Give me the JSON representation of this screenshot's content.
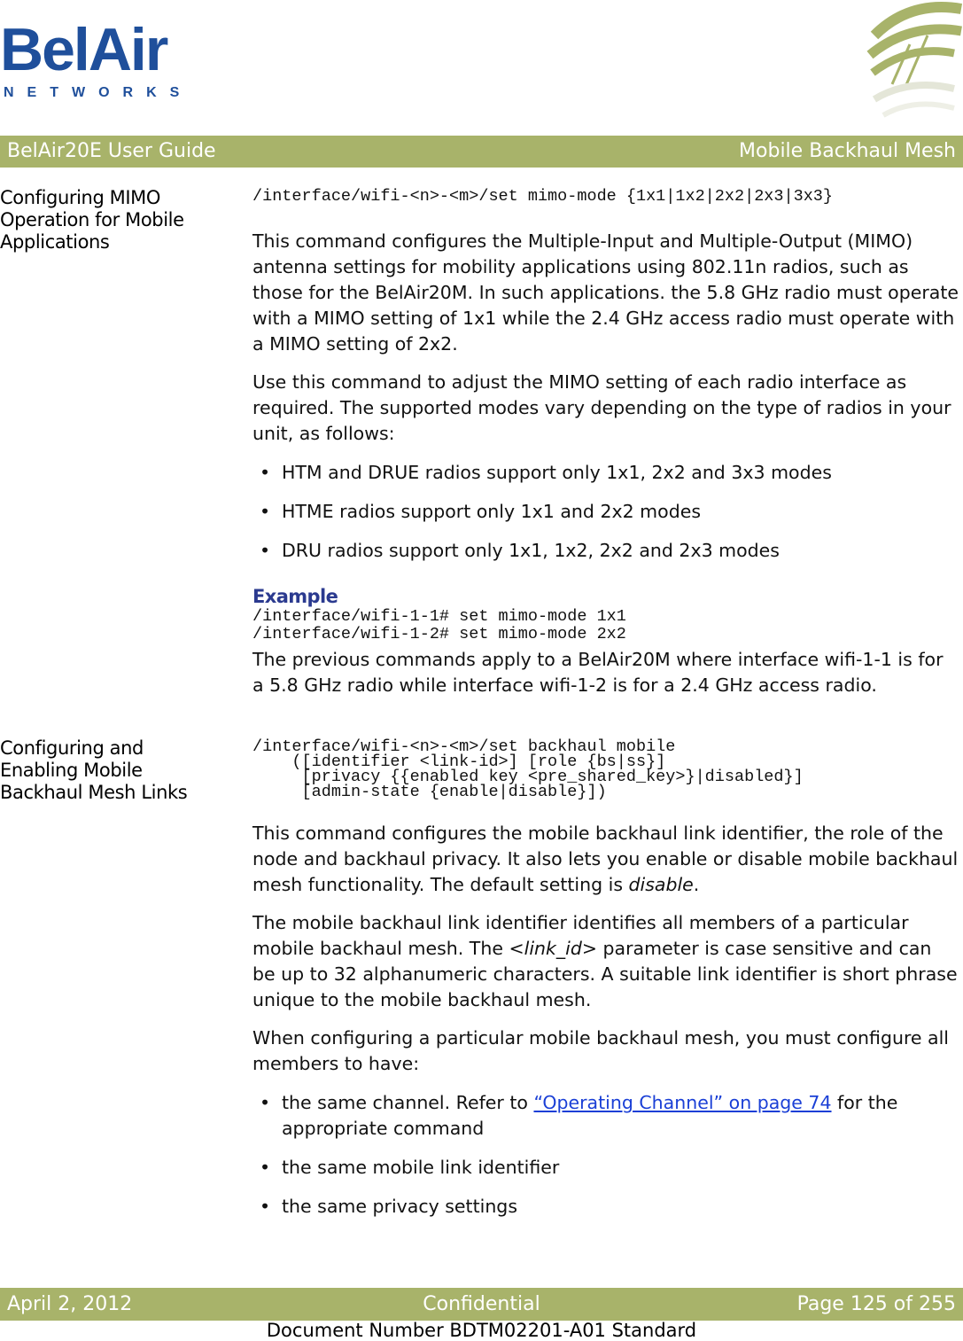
{
  "logo": {
    "word": "BelAir",
    "sub": "NETWORKS"
  },
  "header": {
    "left": "BelAir20E User Guide",
    "right": "Mobile Backhaul Mesh"
  },
  "section1": {
    "title_lines": [
      "Configuring MIMO",
      "Operation for Mobile",
      "Applications"
    ],
    "command": "/interface/wifi-<n>-<m>/set mimo-mode {1x1|1x2|2x2|2x3|3x3}",
    "para1": "This command configures the Multiple-Input and Multiple-Output (MIMO) antenna settings for mobility applications using 802.11n radios, such as those for the BelAir20M. In such applications. the 5.8 GHz radio must operate with a MIMO setting of 1x1 while the 2.4 GHz access radio must operate with a MIMO setting of 2x2.",
    "para2": "Use this command to adjust the MIMO setting of each radio interface as required. The supported modes vary depending on the type of radios in your unit, as follows:",
    "bullets": [
      "HTM and DRUE radios support only 1x1, 2x2 and 3x3 modes",
      "HTME radios support only 1x1 and 2x2 modes",
      "DRU radios support only 1x1, 1x2, 2x2 and 2x3 modes"
    ],
    "example_heading": "Example",
    "example_code": "/interface/wifi-1-1# set mimo-mode 1x1\n/interface/wifi-1-2# set mimo-mode 2x2",
    "para3": "The previous commands apply to a BelAir20M where interface wifi-1-1 is for a 5.8 GHz radio while interface wifi-1-2 is for a 2.4 GHz access radio."
  },
  "section2": {
    "title_lines": [
      "Configuring and",
      "Enabling Mobile",
      "Backhaul Mesh Links"
    ],
    "command": "/interface/wifi-<n>-<m>/set backhaul mobile\n    ([identifier <link-id>] [role {bs|ss}]\n     [privacy {{enabled key <pre_shared_key>}|disabled}]\n     [admin-state {enable|disable}])",
    "para1_pre": "This command configures the mobile backhaul link identifier, the role of the node and backhaul privacy. It also lets you enable or disable mobile backhaul mesh functionality. The default setting is ",
    "para1_em": "disable",
    "para1_post": ".",
    "para2_pre": "The mobile backhaul link identifier identifies all members of a particular mobile backhaul mesh. The ",
    "para2_em": "<link_id>",
    "para2_post": " parameter is case sensitive and can be up to 32 alphanumeric characters. A suitable link identifier is short phrase unique to the mobile backhaul mesh.",
    "para3": "When configuring a particular mobile backhaul mesh, you must configure all members to have:",
    "bullet1_pre": "the same channel. Refer to ",
    "bullet1_link": "“Operating Channel” on page 74",
    "bullet1_post": " for the appropriate command",
    "bullet2": "the same mobile link identifier",
    "bullet3": "the same privacy settings"
  },
  "footer": {
    "date": "April 2, 2012",
    "classification": "Confidential",
    "page": "Page 125 of 255",
    "doc_number": "Document Number BDTM02201-A01 Standard"
  },
  "colors": {
    "brand_blue": "#1f4f9b",
    "bar_green": "#a8b36a",
    "example_heading": "#2b3a8f",
    "link": "#1a3fd6"
  }
}
